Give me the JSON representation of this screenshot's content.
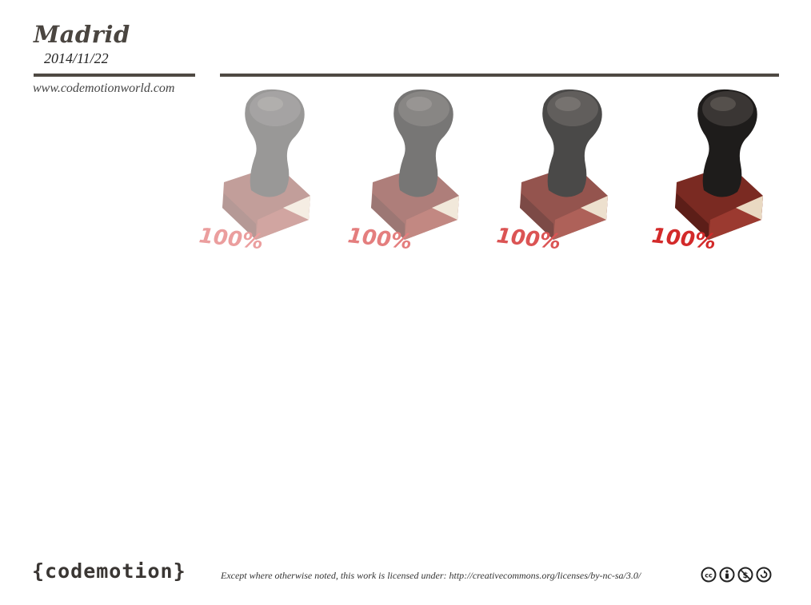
{
  "header": {
    "city": "Madrid",
    "date": "2014/11/22",
    "website": "www.codemotionworld.com"
  },
  "stamps": [
    {
      "label": "100%",
      "opacity": 0.45
    },
    {
      "label": "100%",
      "opacity": 0.6
    },
    {
      "label": "100%",
      "opacity": 0.8
    },
    {
      "label": "100%",
      "opacity": 1.0
    }
  ],
  "footer": {
    "logo": "{codemotion}",
    "license": "Except where otherwise noted, this work is licensed under: http://creativecommons.org/licenses/by-nc-sa/3.0/",
    "cc_icons": [
      "cc-icon",
      "by-icon",
      "nc-icon",
      "sa-icon"
    ]
  }
}
